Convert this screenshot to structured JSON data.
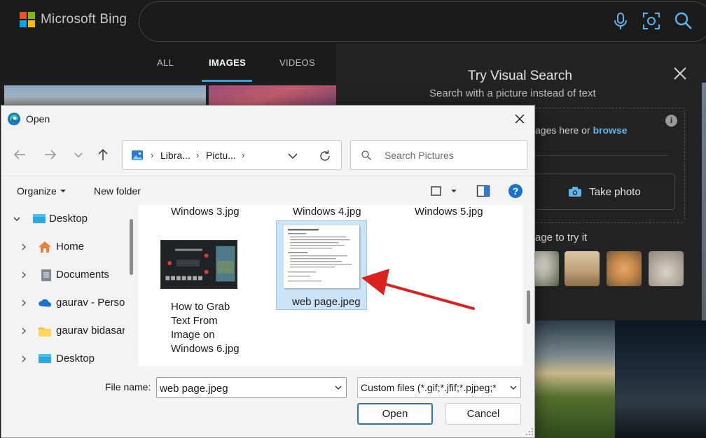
{
  "bing": {
    "logo_text": "Microsoft Bing",
    "tabs": [
      {
        "label": "ALL"
      },
      {
        "label": "IMAGES"
      },
      {
        "label": "VIDEOS"
      }
    ],
    "visual_search": {
      "title": "Try Visual Search",
      "subtitle": "Search with a picture instead of text",
      "drop_text_prefix": "ages here or ",
      "browse_label": "browse",
      "take_photo_label": "Take photo",
      "try_label": "age to try it",
      "info_icon": "i"
    }
  },
  "dialog": {
    "title": "Open",
    "address": {
      "crumbs": [
        "Libra...",
        "Pictu..."
      ]
    },
    "search": {
      "placeholder": "Search Pictures"
    },
    "toolbar": {
      "organize_label": "Organize",
      "new_folder_label": "New folder",
      "help_label": "?"
    },
    "nav_tree": [
      {
        "label": "Desktop",
        "icon": "desktop-icon",
        "expanded": true
      },
      {
        "label": "Home",
        "icon": "home-icon"
      },
      {
        "label": "Documents",
        "icon": "documents-icon"
      },
      {
        "label": "gaurav - Persor",
        "icon": "onedrive-icon"
      },
      {
        "label": "gaurav bidasar",
        "icon": "folder-icon"
      },
      {
        "label": "Desktop",
        "icon": "desktop-icon"
      }
    ],
    "files": {
      "w3": "Windows 3.jpg",
      "w4": "Windows 4.jpg",
      "w5": "Windows 5.jpg",
      "w6_lines": [
        "How to Grab",
        "Text From",
        "Image on",
        "Windows 6.jpg"
      ],
      "web": "web page.jpeg"
    },
    "filename_label": "File name:",
    "filename_value": "web page.jpeg",
    "filetype_value": "Custom files (*.gif;*.jfif;*.pjpeg;*",
    "open_label": "Open",
    "cancel_label": "Cancel"
  },
  "colors": {
    "accent": "#2c6fbf",
    "selection": "#cce4f7",
    "arrow": "#d9211e",
    "bing_tab_accent": "#3a9fd9"
  }
}
